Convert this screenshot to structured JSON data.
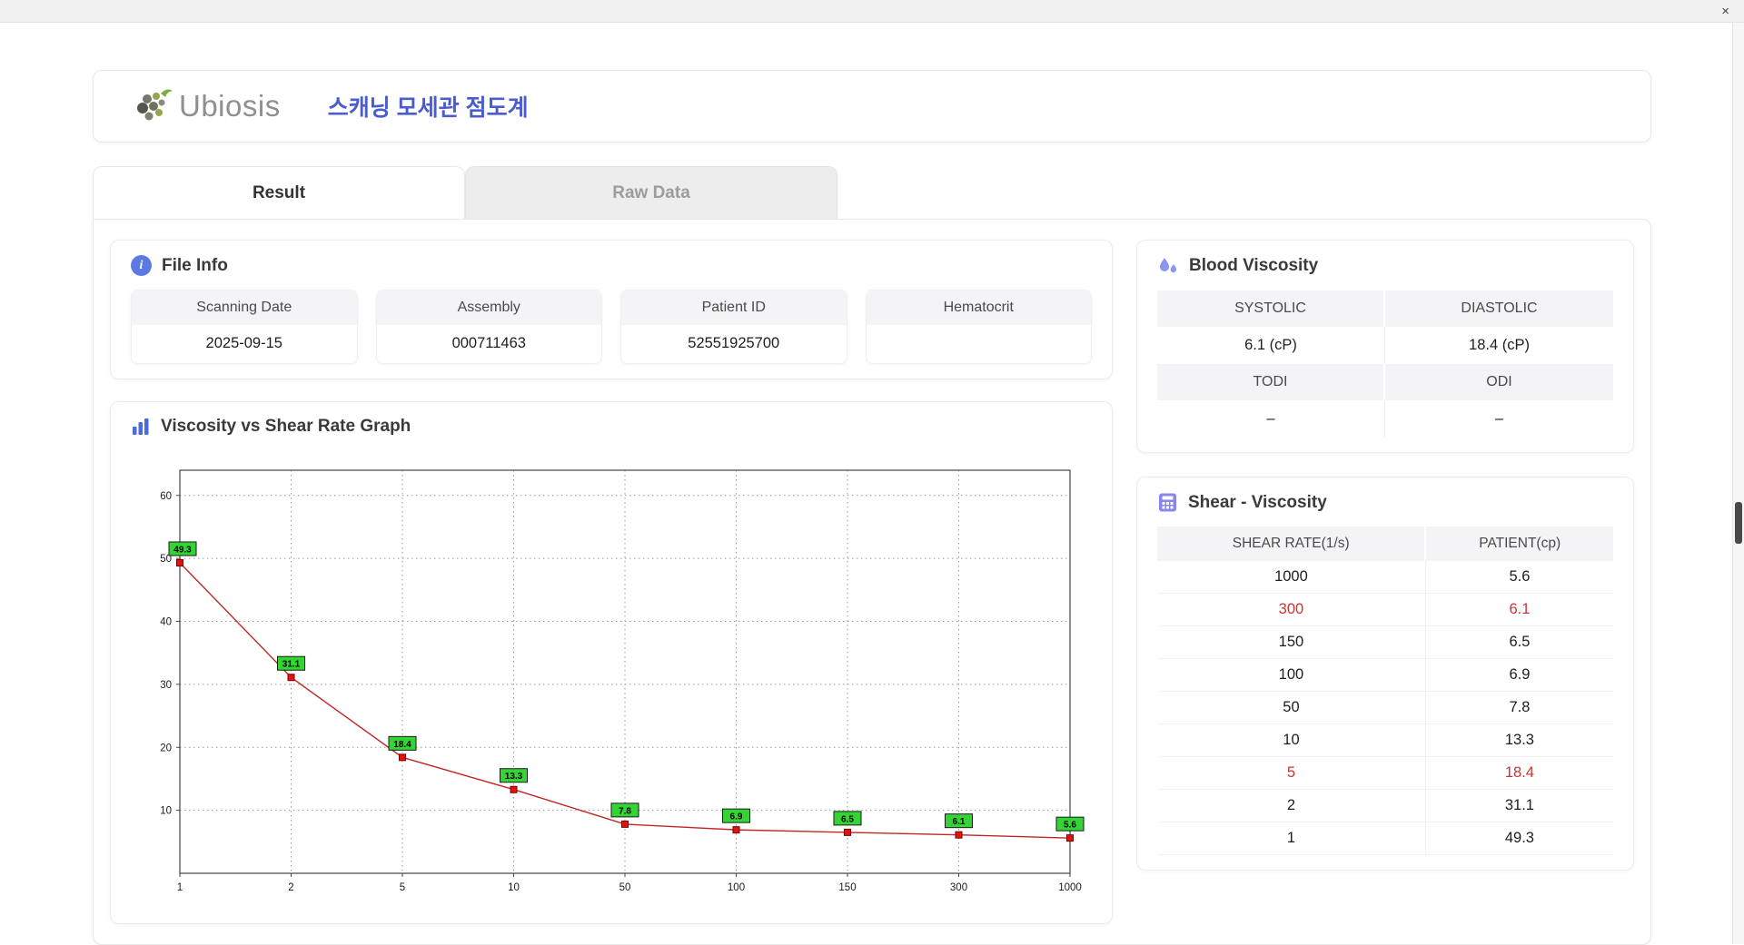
{
  "window": {
    "close_icon": "×"
  },
  "header": {
    "logo_text": "Ubiosis",
    "title": "스캐닝 모세관 점도계"
  },
  "tabs": [
    {
      "label": "Result",
      "active": true
    },
    {
      "label": "Raw Data",
      "active": false
    }
  ],
  "file_info": {
    "title": "File Info",
    "fields": [
      {
        "label": "Scanning Date",
        "value": "2025-09-15"
      },
      {
        "label": "Assembly",
        "value": "000711463"
      },
      {
        "label": "Patient ID",
        "value": "52551925700"
      },
      {
        "label": "Hematocrit",
        "value": ""
      }
    ]
  },
  "blood_viscosity": {
    "title": "Blood Viscosity",
    "rows": [
      [
        {
          "label": "SYSTOLIC",
          "value": "6.1 (cP)"
        },
        {
          "label": "DIASTOLIC",
          "value": "18.4 (cP)"
        }
      ],
      [
        {
          "label": "TODI",
          "value": "–"
        },
        {
          "label": "ODI",
          "value": "–"
        }
      ]
    ]
  },
  "graph": {
    "title": "Viscosity vs Shear Rate Graph"
  },
  "chart_data": {
    "type": "line",
    "title": "Viscosity vs Shear Rate Graph",
    "x": [
      1,
      2,
      5,
      10,
      50,
      100,
      150,
      300,
      1000
    ],
    "values": [
      49.3,
      31.1,
      18.4,
      13.3,
      7.8,
      6.9,
      6.5,
      6.1,
      5.6
    ],
    "xlabel": "",
    "ylabel": "",
    "ylim": [
      0,
      64
    ],
    "yticks": [
      10,
      20,
      30,
      40,
      50,
      60
    ],
    "x_scale": "category",
    "grid": true,
    "line_color": "#c22626",
    "marker_color": "#e01212",
    "marker_border": "#7a0000",
    "label_bg": "#35d435",
    "label_border": "#1a1a1a"
  },
  "shear_table": {
    "title": "Shear - Viscosity",
    "columns": [
      "SHEAR RATE(1/s)",
      "PATIENT(cp)"
    ],
    "rows": [
      {
        "shear": "1000",
        "patient": "5.6",
        "highlight": false
      },
      {
        "shear": "300",
        "patient": "6.1",
        "highlight": true
      },
      {
        "shear": "150",
        "patient": "6.5",
        "highlight": false
      },
      {
        "shear": "100",
        "patient": "6.9",
        "highlight": false
      },
      {
        "shear": "50",
        "patient": "7.8",
        "highlight": false
      },
      {
        "shear": "10",
        "patient": "13.3",
        "highlight": false
      },
      {
        "shear": "5",
        "patient": "18.4",
        "highlight": true
      },
      {
        "shear": "2",
        "patient": "31.1",
        "highlight": false
      },
      {
        "shear": "1",
        "patient": "49.3",
        "highlight": false
      }
    ]
  }
}
